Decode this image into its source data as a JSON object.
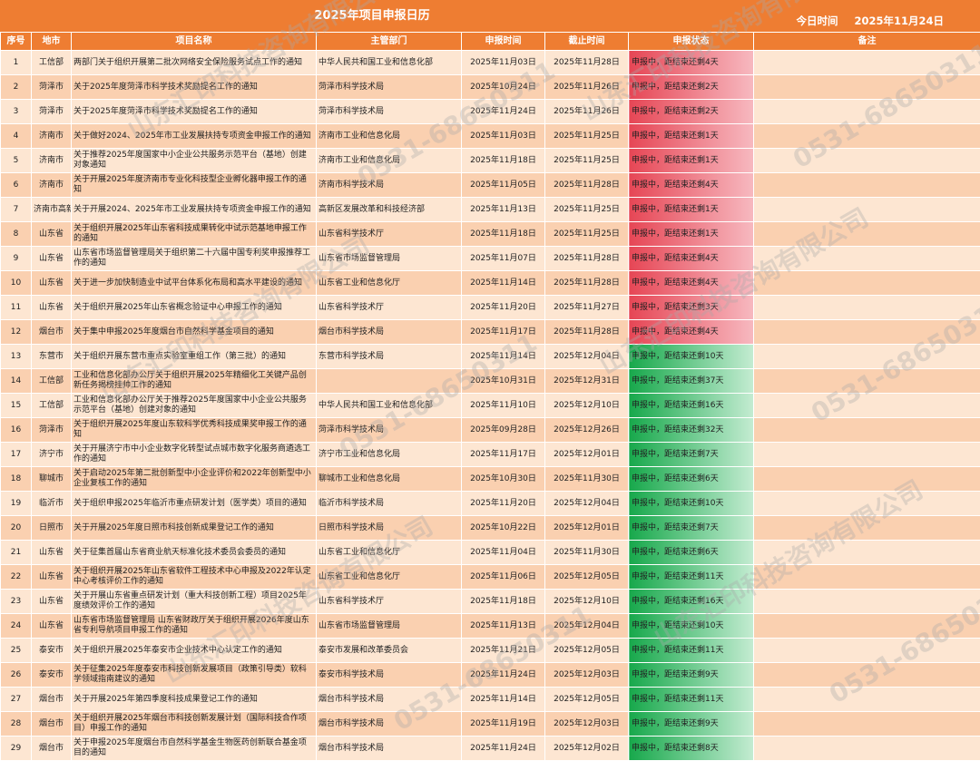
{
  "header": {
    "title": "2025年项目申报日历",
    "today_label": "今日时间",
    "today_value": "2025年11月24日"
  },
  "columns": [
    "序号",
    "地市",
    "项目名称",
    "主管部门",
    "申报时间",
    "截止时间",
    "申报状态",
    "备注"
  ],
  "rows": [
    {
      "no": "1",
      "city": "工信部",
      "name": "两部门关于组织开展第二批次网络安全保险服务试点工作的通知",
      "dept": "中华人民共和国工业和信息化部",
      "start": "2025年11月03日",
      "end": "2025年11月28日",
      "status": "申报中，距结束还剩4天",
      "status_color": "red",
      "note": ""
    },
    {
      "no": "2",
      "city": "菏泽市",
      "name": "关于2025年度菏泽市科学技术奖励提名工作的通知",
      "dept": "菏泽市科学技术局",
      "start": "2025年10月24日",
      "end": "2025年11月26日",
      "status": "申报中，距结束还剩2天",
      "status_color": "red",
      "note": ""
    },
    {
      "no": "3",
      "city": "菏泽市",
      "name": "关于2025年度菏泽市科学技术奖励提名工作的通知",
      "dept": "菏泽市科学技术局",
      "start": "2025年11月24日",
      "end": "2025年11月26日",
      "status": "申报中，距结束还剩2天",
      "status_color": "red",
      "note": ""
    },
    {
      "no": "4",
      "city": "济南市",
      "name": "关于做好2024、2025年市工业发展扶持专项资金申报工作的通知",
      "dept": "济南市工业和信息化局",
      "start": "2025年11月03日",
      "end": "2025年11月25日",
      "status": "申报中，距结束还剩1天",
      "status_color": "red",
      "note": ""
    },
    {
      "no": "5",
      "city": "济南市",
      "name": "关于推荐2025年度国家中小企业公共服务示范平台（基地）创建对象通知",
      "dept": "济南市工业和信息化局",
      "start": "2025年11月18日",
      "end": "2025年11月25日",
      "status": "申报中，距结束还剩1天",
      "status_color": "red",
      "note": ""
    },
    {
      "no": "6",
      "city": "济南市",
      "name": "关于开展2025年度济南市专业化科技型企业孵化器申报工作的通知",
      "dept": "济南市科学技术局",
      "start": "2025年11月05日",
      "end": "2025年11月28日",
      "status": "申报中，距结束还剩4天",
      "status_color": "red",
      "note": ""
    },
    {
      "no": "7",
      "city": "济南市高新区",
      "name": "关于开展2024、2025年市工业发展扶持专项资金申报工作的通知",
      "dept": "高新区发展改革和科技经济部",
      "start": "2025年11月13日",
      "end": "2025年11月25日",
      "status": "申报中，距结束还剩1天",
      "status_color": "red",
      "note": ""
    },
    {
      "no": "8",
      "city": "山东省",
      "name": "关于组织开展2025年山东省科技成果转化中试示范基地申报工作的通知",
      "dept": "山东省科学技术厅",
      "start": "2025年11月18日",
      "end": "2025年11月25日",
      "status": "申报中，距结束还剩1天",
      "status_color": "red",
      "note": ""
    },
    {
      "no": "9",
      "city": "山东省",
      "name": "山东省市场监督管理局关于组织第二十六届中国专利奖申报推荐工作的通知",
      "dept": "山东省市场监督管理局",
      "start": "2025年11月07日",
      "end": "2025年11月28日",
      "status": "申报中，距结束还剩4天",
      "status_color": "red",
      "note": ""
    },
    {
      "no": "10",
      "city": "山东省",
      "name": "关于进一步加快制造业中试平台体系化布局和高水平建设的通知",
      "dept": "山东省工业和信息化厅",
      "start": "2025年11月14日",
      "end": "2025年11月28日",
      "status": "申报中，距结束还剩4天",
      "status_color": "red",
      "note": ""
    },
    {
      "no": "11",
      "city": "山东省",
      "name": "关于组织开展2025年山东省概念验证中心申报工作的通知",
      "dept": "山东省科学技术厅",
      "start": "2025年11月20日",
      "end": "2025年11月27日",
      "status": "申报中，距结束还剩3天",
      "status_color": "red",
      "note": ""
    },
    {
      "no": "12",
      "city": "烟台市",
      "name": "关于集中申报2025年度烟台市自然科学基金项目的通知",
      "dept": "烟台市科学技术局",
      "start": "2025年11月17日",
      "end": "2025年11月28日",
      "status": "申报中，距结束还剩4天",
      "status_color": "red",
      "note": ""
    },
    {
      "no": "13",
      "city": "东营市",
      "name": "关于组织开展东营市重点实验室重组工作（第三批）的通知",
      "dept": "东营市科学技术局",
      "start": "2025年11月14日",
      "end": "2025年12月04日",
      "status": "申报中，距结束还剩10天",
      "status_color": "green",
      "note": ""
    },
    {
      "no": "14",
      "city": "工信部",
      "name": "工业和信息化部办公厅关于组织开展2025年精细化工关键产品创新任务揭榜挂帅工作的通知",
      "dept": "",
      "start": "2025年10月31日",
      "end": "2025年12月31日",
      "status": "申报中，距结束还剩37天",
      "status_color": "green",
      "note": ""
    },
    {
      "no": "15",
      "city": "工信部",
      "name": "工业和信息化部办公厅关于推荐2025年度国家中小企业公共服务示范平台（基地）创建对象的通知",
      "dept": "中华人民共和国工业和信息化部",
      "start": "2025年11月10日",
      "end": "2025年12月10日",
      "status": "申报中，距结束还剩16天",
      "status_color": "green",
      "note": ""
    },
    {
      "no": "16",
      "city": "菏泽市",
      "name": "关于组织开展2025年度山东软科学优秀科技成果奖申报工作的通知",
      "dept": "菏泽市科学技术局",
      "start": "2025年09月28日",
      "end": "2025年12月26日",
      "status": "申报中，距结束还剩32天",
      "status_color": "green",
      "note": ""
    },
    {
      "no": "17",
      "city": "济宁市",
      "name": "关于开展济宁市中小企业数字化转型试点城市数字化服务商遴选工作的通知",
      "dept": "济宁市工业和信息化局",
      "start": "2025年11月17日",
      "end": "2025年12月01日",
      "status": "申报中，距结束还剩7天",
      "status_color": "green",
      "note": ""
    },
    {
      "no": "18",
      "city": "聊城市",
      "name": "关于启动2025年第二批创新型中小企业评价和2022年创新型中小企业复核工作的通知",
      "dept": "聊城市工业和信息化局",
      "start": "2025年10月30日",
      "end": "2025年11月30日",
      "status": "申报中，距结束还剩6天",
      "status_color": "green",
      "note": ""
    },
    {
      "no": "19",
      "city": "临沂市",
      "name": "关于组织申报2025年临沂市重点研发计划（医学类）项目的通知",
      "dept": "临沂市科学技术局",
      "start": "2025年11月20日",
      "end": "2025年12月04日",
      "status": "申报中，距结束还剩10天",
      "status_color": "green",
      "note": ""
    },
    {
      "no": "20",
      "city": "日照市",
      "name": "关于开展2025年度日照市科技创新成果登记工作的通知",
      "dept": "日照市科学技术局",
      "start": "2025年10月22日",
      "end": "2025年12月01日",
      "status": "申报中，距结束还剩7天",
      "status_color": "green",
      "note": ""
    },
    {
      "no": "21",
      "city": "山东省",
      "name": "关于征集首届山东省商业航天标准化技术委员会委员的通知",
      "dept": "山东省工业和信息化厅",
      "start": "2025年11月04日",
      "end": "2025年11月30日",
      "status": "申报中，距结束还剩6天",
      "status_color": "green",
      "note": ""
    },
    {
      "no": "22",
      "city": "山东省",
      "name": "关于组织开展2025年山东省软件工程技术中心申报及2022年认定中心考核评价工作的通知",
      "dept": "山东省工业和信息化厅",
      "start": "2025年11月06日",
      "end": "2025年12月05日",
      "status": "申报中，距结束还剩11天",
      "status_color": "green",
      "note": ""
    },
    {
      "no": "23",
      "city": "山东省",
      "name": "关于开展山东省重点研发计划（重大科技创新工程）项目2025年度绩效评价工作的通知",
      "dept": "山东省科学技术厅",
      "start": "2025年11月18日",
      "end": "2025年12月10日",
      "status": "申报中，距结束还剩16天",
      "status_color": "green",
      "note": ""
    },
    {
      "no": "24",
      "city": "山东省",
      "name": "山东省市场监督管理局 山东省财政厅关于组织开展2026年度山东省专利导航项目申报工作的通知",
      "dept": "山东省市场监督管理局",
      "start": "2025年11月13日",
      "end": "2025年12月04日",
      "status": "申报中，距结束还剩10天",
      "status_color": "green",
      "note": ""
    },
    {
      "no": "25",
      "city": "泰安市",
      "name": "关于组织开展2025年泰安市企业技术中心认定工作的通知",
      "dept": "泰安市发展和改革委员会",
      "start": "2025年11月21日",
      "end": "2025年12月05日",
      "status": "申报中，距结束还剩11天",
      "status_color": "green",
      "note": ""
    },
    {
      "no": "26",
      "city": "泰安市",
      "name": "关于征集2025年度泰安市科技创新发展项目（政策引导类）软科学领域指南建议的通知",
      "dept": "泰安市科学技术局",
      "start": "2025年11月24日",
      "end": "2025年12月03日",
      "status": "申报中，距结束还剩9天",
      "status_color": "green",
      "note": ""
    },
    {
      "no": "27",
      "city": "烟台市",
      "name": "关于开展2025年第四季度科技成果登记工作的通知",
      "dept": "烟台市科学技术局",
      "start": "2025年11月14日",
      "end": "2025年12月05日",
      "status": "申报中，距结束还剩11天",
      "status_color": "green",
      "note": ""
    },
    {
      "no": "28",
      "city": "烟台市",
      "name": "关于组织开展2025年烟台市科技创新发展计划（国际科技合作项目）申报工作的通知",
      "dept": "烟台市科学技术局",
      "start": "2025年11月19日",
      "end": "2025年12月03日",
      "status": "申报中，距结束还剩9天",
      "status_color": "green",
      "note": ""
    },
    {
      "no": "29",
      "city": "烟台市",
      "name": "关于申报2025年度烟台市自然科学基金生物医药创新联合基金项目的通知",
      "dept": "烟台市科学技术局",
      "start": "2025年11月24日",
      "end": "2025年12月02日",
      "status": "申报中，距结束还剩8天",
      "status_color": "green",
      "note": ""
    }
  ],
  "watermark": [
    "山东汇印科技咨询有限公司",
    "0531-68650311"
  ],
  "colors": {
    "header_bg": "#ee7d32",
    "row_even": "#fde6d2",
    "row_odd": "#fad0b0",
    "status_red": "#e64655",
    "status_green": "#17a84b"
  }
}
